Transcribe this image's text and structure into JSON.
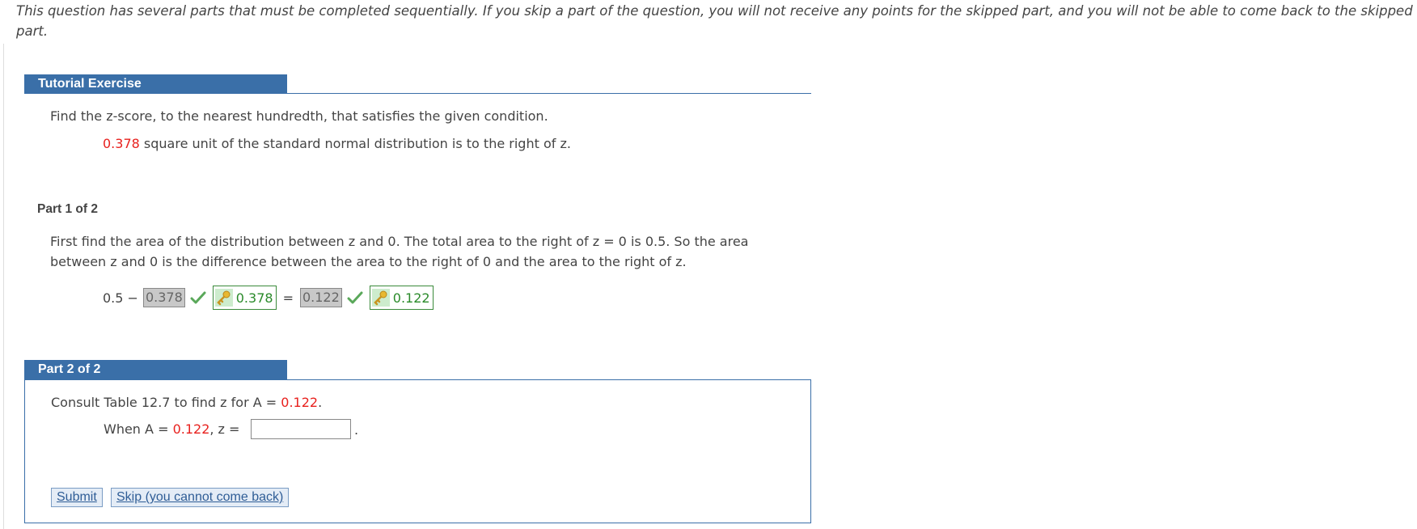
{
  "instructions": "This question has several parts that must be completed sequentially. If you skip a part of the question, you will not receive any points for the skipped part, and you will not be able to come back to the skipped part.",
  "tutorial": {
    "header": "Tutorial Exercise",
    "prompt": "Find the z-score, to the nearest hundredth, that satisfies the given condition.",
    "condition_value": "0.378",
    "condition_text": " square unit of the standard normal distribution is to the right of z."
  },
  "part1": {
    "label": "Part 1 of 2",
    "line1": "First find the area of the distribution between z and 0. The total area to the right of z = 0 is 0.5. So the area",
    "line2": "between z and 0 is the difference between the area to the right of 0 and the area to the right of z.",
    "eq_start": "0.5 −",
    "answer1": "0.378",
    "key1": "0.378",
    "equals": "=",
    "answer2": "0.122",
    "key2": "0.122"
  },
  "part2": {
    "label": "Part 2 of 2",
    "consult_pre": "Consult Table 12.7 to find z for A = ",
    "consult_val": "0.122",
    "consult_post": ".",
    "when_pre": "When A = ",
    "when_val": "0.122",
    "when_post": ", z =",
    "input_value": "",
    "period": ".",
    "submit_label": "Submit",
    "skip_label": "Skip (you cannot come back)"
  },
  "colors": {
    "accent": "#3a6fa8",
    "highlight": "#e8211e",
    "correct": "#2a8a2a"
  },
  "icons": [
    "check-icon",
    "key-icon"
  ]
}
